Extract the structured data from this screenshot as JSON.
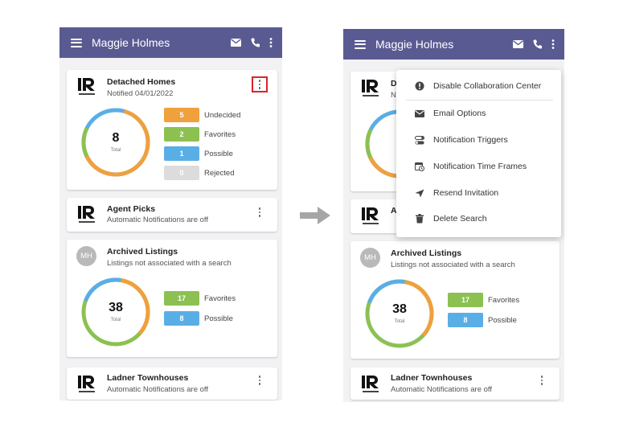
{
  "header": {
    "title": "Maggie Holmes",
    "icons": [
      "menu-icon",
      "mail-icon",
      "phone-icon",
      "more-vert-icon"
    ],
    "color": "#5a5a92"
  },
  "left": {
    "detached": {
      "title": "Detached Homes",
      "subtitle": "Notified 04/01/2022",
      "total": "8",
      "total_label": "Total",
      "stats": [
        {
          "value": "5",
          "label": "Undecided",
          "color": "#f0a03c"
        },
        {
          "value": "2",
          "label": "Favorites",
          "color": "#8cc152"
        },
        {
          "value": "1",
          "label": "Possible",
          "color": "#5aaee6"
        },
        {
          "value": "0",
          "label": "Rejected",
          "color": "#dcdcdc"
        }
      ]
    },
    "agent_picks": {
      "title": "Agent Picks",
      "subtitle": "Automatic Notifications are off"
    },
    "archived": {
      "avatar": "MH",
      "title": "Archived Listings",
      "subtitle": "Listings not associated with a search",
      "total": "38",
      "total_label": "Total",
      "stats": [
        {
          "value": "17",
          "label": "Favorites",
          "color": "#8cc152"
        },
        {
          "value": "8",
          "label": "Possible",
          "color": "#5aaee6"
        }
      ]
    },
    "ladner": {
      "title": "Ladner Townhouses",
      "subtitle": "Automatic Notifications are off"
    }
  },
  "right": {
    "detached": {
      "title": "Detached Homes",
      "title_visible": "D",
      "subtitle_visible": "N"
    },
    "agent_picks": {
      "title_visible": "A"
    },
    "archived": {
      "avatar": "MH",
      "title": "Archived Listings",
      "subtitle": "Listings not associated with a search",
      "total": "38",
      "total_label": "Total",
      "stats": [
        {
          "value": "17",
          "label": "Favorites",
          "color": "#8cc152"
        },
        {
          "value": "8",
          "label": "Possible",
          "color": "#5aaee6"
        }
      ]
    },
    "ladner": {
      "title": "Ladner Townhouses",
      "subtitle": "Automatic Notifications are off"
    }
  },
  "menu": {
    "items": [
      {
        "icon": "info-icon",
        "label": "Disable Collaboration Center"
      },
      {
        "icon": "mail-icon",
        "label": "Email Options"
      },
      {
        "icon": "toggle-icon",
        "label": "Notification Triggers"
      },
      {
        "icon": "calendar-clock-icon",
        "label": "Notification Time Frames"
      },
      {
        "icon": "send-icon",
        "label": "Resend Invitation"
      },
      {
        "icon": "trash-icon",
        "label": "Delete Search"
      }
    ]
  },
  "donut_colors": {
    "orange": "#f0a03c",
    "green": "#8cc152",
    "blue": "#5aaee6"
  },
  "highlight_color": "#d9242a"
}
